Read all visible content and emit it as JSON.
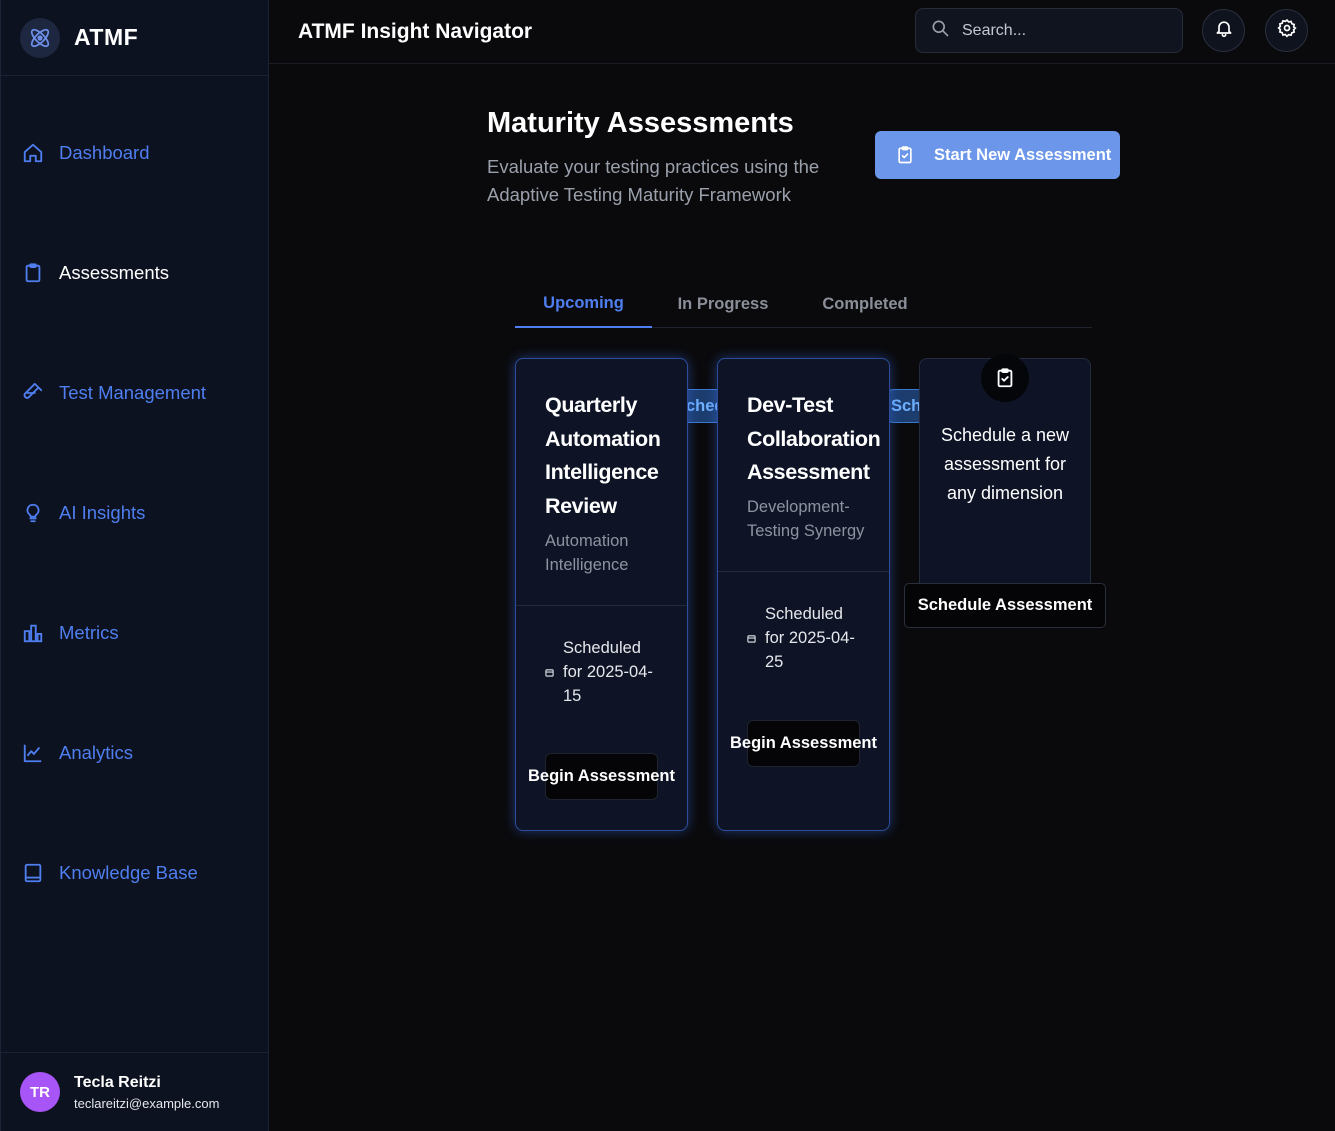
{
  "brand": {
    "name": "ATMF"
  },
  "header": {
    "title": "ATMF Insight Navigator",
    "search_placeholder": "Search..."
  },
  "sidebar": {
    "items": [
      {
        "label": "Dashboard",
        "icon": "home-icon"
      },
      {
        "label": "Assessments",
        "icon": "clipboard-icon",
        "active": true
      },
      {
        "label": "Test Management",
        "icon": "beaker-icon"
      },
      {
        "label": "AI Insights",
        "icon": "lightbulb-icon"
      },
      {
        "label": "Metrics",
        "icon": "bar-chart-icon"
      },
      {
        "label": "Analytics",
        "icon": "line-chart-icon"
      },
      {
        "label": "Knowledge Base",
        "icon": "book-icon"
      }
    ]
  },
  "user": {
    "initials": "TR",
    "name": "Tecla Reitzi",
    "email": "teclareitzi@example.com"
  },
  "main": {
    "title": "Maturity Assessments",
    "subtitle": "Evaluate your testing practices using the Adaptive Testing Maturity Framework",
    "new_button": "Start New Assessment",
    "tabs": [
      {
        "label": "Upcoming",
        "active": true
      },
      {
        "label": "In Progress"
      },
      {
        "label": "Completed"
      }
    ],
    "cards": [
      {
        "title": "Quarterly Automation Intelligence Review",
        "badge": "Sched",
        "dimension": "Automation Intelligence",
        "scheduled": "Scheduled for 2025-04-15",
        "button": "Begin Assessment"
      },
      {
        "title": "Dev-Test Collaboration Assessment",
        "badge": "Sch",
        "dimension": "Development-Testing Synergy",
        "scheduled": "Scheduled for 2025-04-25",
        "button": "Begin Assessment"
      }
    ],
    "new_card": {
      "text": "Schedule a new assessment for any dimension",
      "button": "Schedule Assessment"
    }
  },
  "colors": {
    "accent": "#4f7ef0",
    "primary_button": "#6b96ea",
    "avatar": "#a855f7",
    "badge_text": "#6eb0ff"
  }
}
